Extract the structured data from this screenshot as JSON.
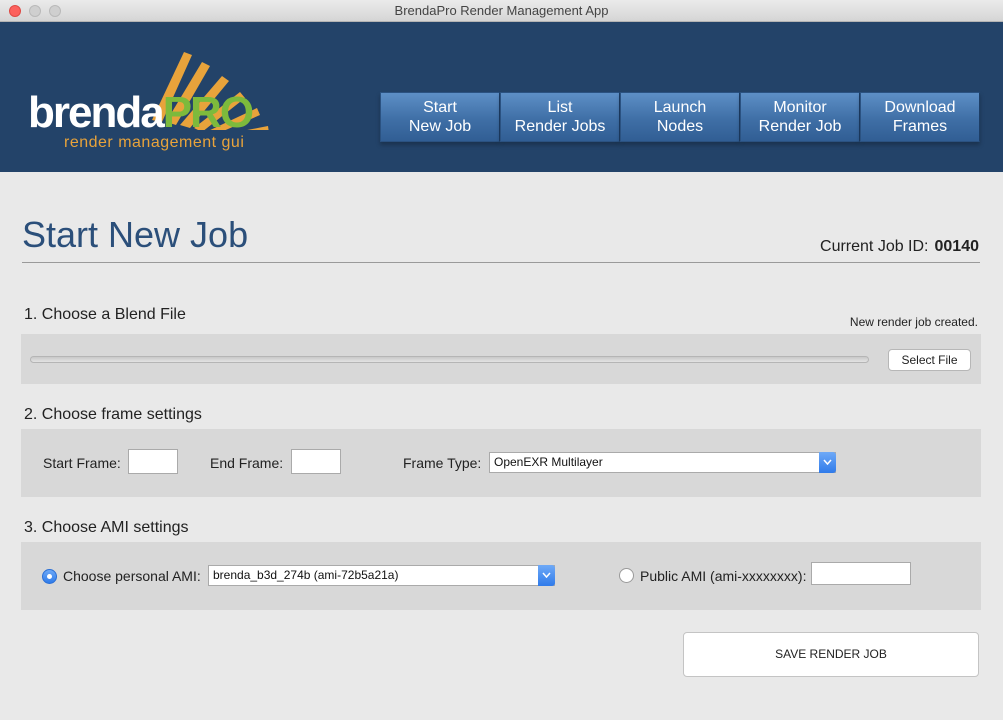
{
  "window": {
    "title": "BrendaPro Render Management App"
  },
  "logo": {
    "brand_main": "brenda",
    "brand_accent": "PRO",
    "subtitle": "render management gui"
  },
  "nav": {
    "items": [
      {
        "label": "Start\nNew Job"
      },
      {
        "label": "List\nRender Jobs"
      },
      {
        "label": "Launch\nNodes"
      },
      {
        "label": "Monitor\nRender Job"
      },
      {
        "label": "Download\nFrames"
      }
    ]
  },
  "page": {
    "title": "Start New Job",
    "job_id_label": "Current Job ID:",
    "job_id_value": "00140"
  },
  "section1": {
    "title": "1. Choose a Blend File",
    "status": "New render job created.",
    "progress": 0,
    "select_file_label": "Select File"
  },
  "section2": {
    "title": "2. Choose frame settings",
    "start_frame_label": "Start Frame:",
    "start_frame_value": "",
    "end_frame_label": "End Frame:",
    "end_frame_value": "",
    "frame_type_label": "Frame Type:",
    "frame_type_value": "OpenEXR Multilayer"
  },
  "section3": {
    "title": "3. Choose AMI settings",
    "personal_ami_label": "Choose personal AMI:",
    "personal_ami_value": "brenda_b3d_274b (ami-72b5a21a)",
    "public_ami_label": "Public AMI (ami-xxxxxxxx):",
    "public_ami_value": ""
  },
  "actions": {
    "save_label": "SAVE RENDER JOB"
  },
  "colors": {
    "header_bg": "#234369",
    "nav_button": "#4a7db5",
    "title_text": "#2b4f7a",
    "logo_green": "#7dba3c",
    "logo_orange": "#e8a33b",
    "accent_blue": "#2f7bea"
  }
}
